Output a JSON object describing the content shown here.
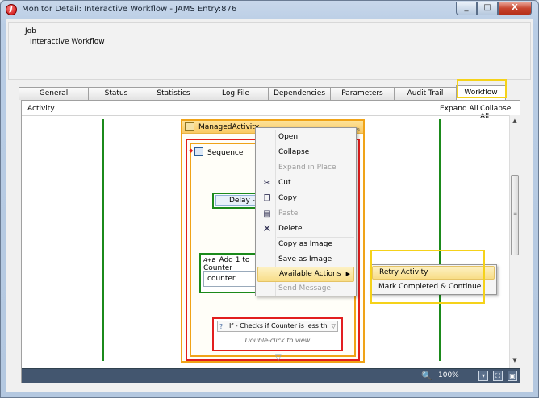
{
  "window": {
    "title": "Monitor Detail: Interactive Workflow - JAMS Entry:876",
    "app_icon_letter": "J",
    "minimize": "_",
    "maximize": "□",
    "close": "X"
  },
  "job": {
    "label": "Job",
    "value": "Interactive Workflow"
  },
  "tabs": [
    {
      "label": "General"
    },
    {
      "label": "Status"
    },
    {
      "label": "Statistics"
    },
    {
      "label": "Log File"
    },
    {
      "label": "Dependencies"
    },
    {
      "label": "Parameters"
    },
    {
      "label": "Audit Trail"
    },
    {
      "label": "Workflow"
    }
  ],
  "activity_bar": {
    "label": "Activity",
    "expand_all": "Expand All",
    "collapse_all": "Collapse All"
  },
  "workflow": {
    "managed_activity": "ManagedActivity",
    "sequence": "Sequence",
    "delay": "Delay - 10s",
    "add_label": "Add 1 to Counter",
    "add_prefix": "A+B",
    "add_field": "counter",
    "if_title": "If - Checks if Counter is less th",
    "if_hint": "Double-click to view"
  },
  "context_menu": {
    "items": [
      {
        "label": "Open"
      },
      {
        "label": "Collapse"
      },
      {
        "label": "Expand in Place"
      },
      {
        "label": "Cut"
      },
      {
        "label": "Copy"
      },
      {
        "label": "Paste"
      },
      {
        "label": "Delete"
      },
      {
        "label": "Copy as Image"
      },
      {
        "label": "Save as Image"
      },
      {
        "label": "Available Actions"
      },
      {
        "label": "Send Message"
      }
    ]
  },
  "submenu": {
    "items": [
      {
        "label": "Retry Activity"
      },
      {
        "label": "Mark Completed & Continue"
      }
    ]
  },
  "status_strip": {
    "zoom": "100%"
  }
}
